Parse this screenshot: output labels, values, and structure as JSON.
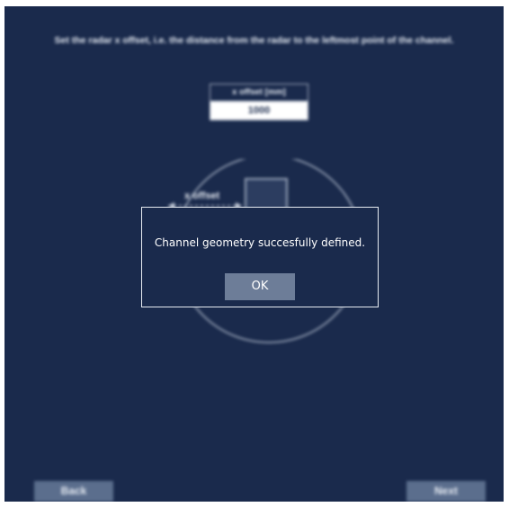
{
  "background": {
    "instruction": "Set the radar x offset, i.e. the distance from the radar to the leftmost point of the channel.",
    "offset_field": {
      "label": "x offset [mm]",
      "value": "1000"
    },
    "diagram": {
      "label": "x offset"
    },
    "nav": {
      "back_label": "Back",
      "next_label": "Next"
    }
  },
  "dialog": {
    "message": "Channel geometry succesfully defined.",
    "ok_label": "OK"
  },
  "colors": {
    "background": "#1a2a4c",
    "button": "#5b6e8d",
    "dialog_button": "#6d7d98",
    "text": "#e6ebf3"
  }
}
